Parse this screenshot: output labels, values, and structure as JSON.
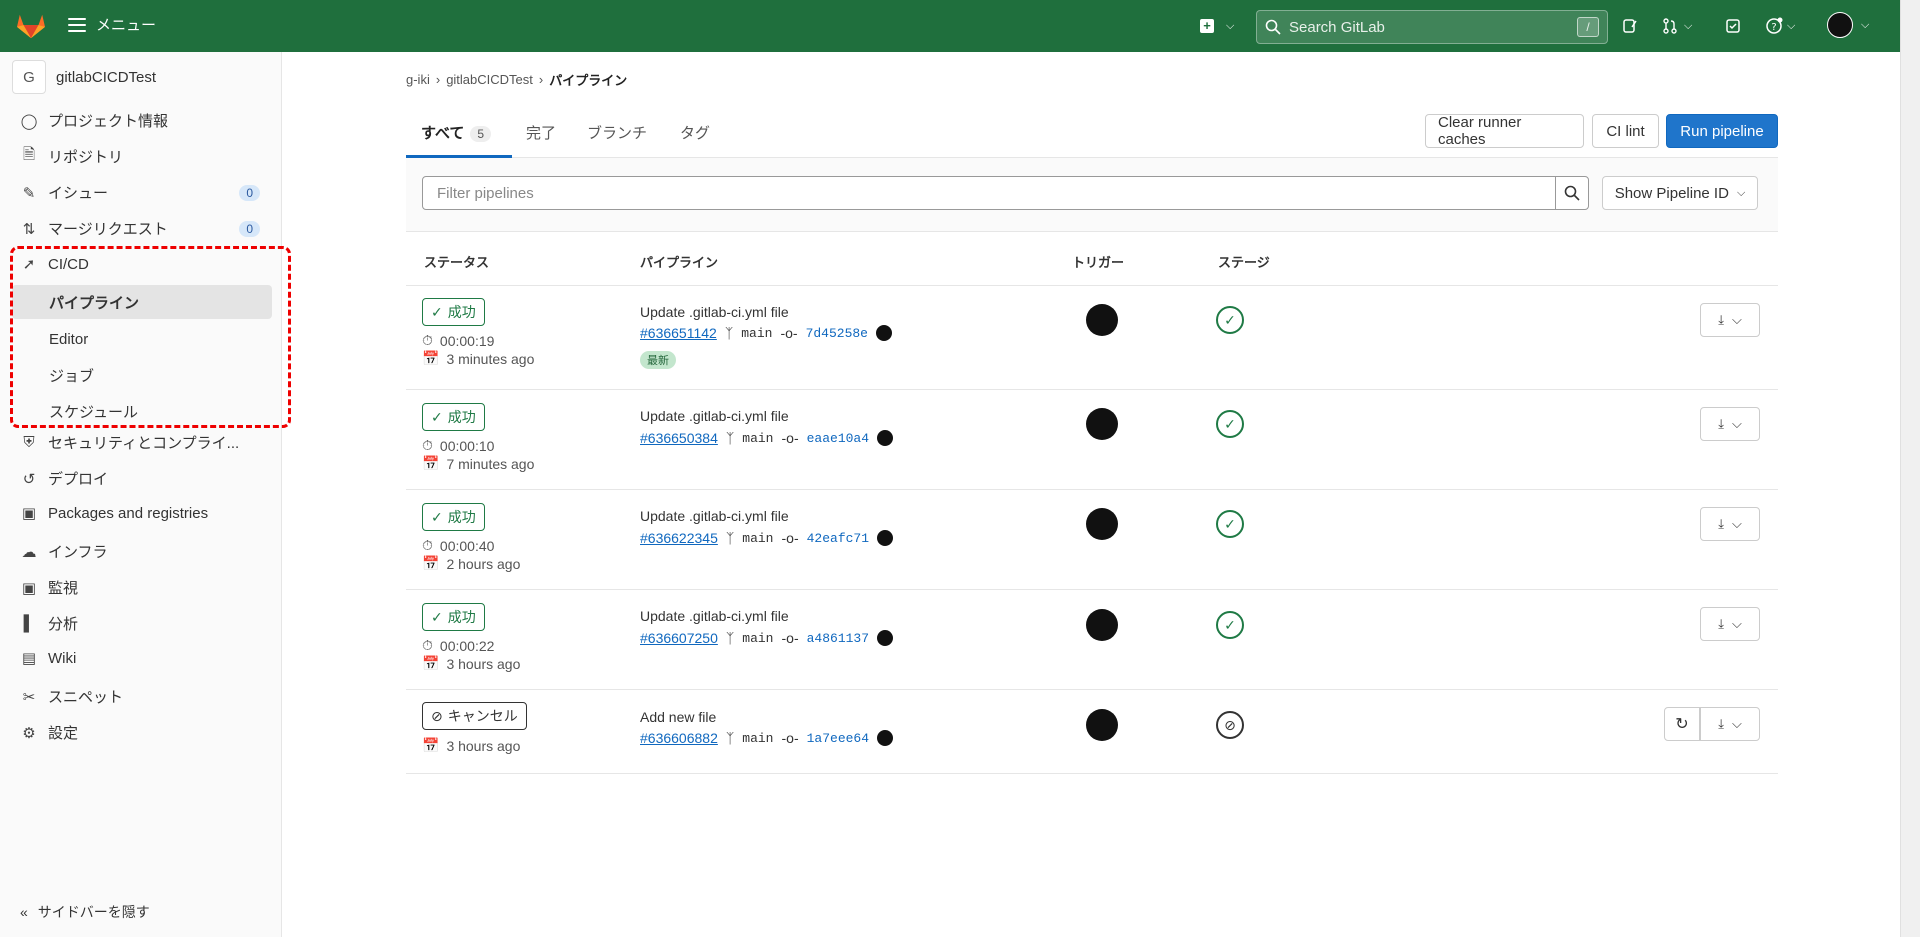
{
  "topbar": {
    "menu_label": "メニュー",
    "search_placeholder": "Search GitLab",
    "search_shortcut": "/"
  },
  "sidebar": {
    "project_initial": "G",
    "project_name": "gitlabCICDTest",
    "items": [
      {
        "label": "プロジェクト情報",
        "icon": "project-icon"
      },
      {
        "label": "リポジトリ",
        "icon": "document-icon"
      },
      {
        "label": "イシュー",
        "icon": "issues-icon",
        "badge": "0"
      },
      {
        "label": "マージリクエスト",
        "icon": "merge-request-icon",
        "badge": "0"
      },
      {
        "label": "CI/CD",
        "icon": "rocket-icon"
      },
      {
        "label": "セキュリティとコンプライ...",
        "icon": "shield-icon"
      },
      {
        "label": "デプロイ",
        "icon": "deploy-icon"
      },
      {
        "label": "Packages and registries",
        "icon": "package-icon"
      },
      {
        "label": "インフラ",
        "icon": "cloud-icon"
      },
      {
        "label": "監視",
        "icon": "monitor-icon"
      },
      {
        "label": "分析",
        "icon": "chart-icon"
      },
      {
        "label": "Wiki",
        "icon": "book-icon"
      },
      {
        "label": "スニペット",
        "icon": "scissors-icon"
      },
      {
        "label": "設定",
        "icon": "gear-icon"
      }
    ],
    "cicd_sub": [
      "パイプライン",
      "Editor",
      "ジョブ",
      "スケジュール"
    ],
    "hide_label": "サイドバーを隠す"
  },
  "breadcrumb": [
    "g-iki",
    "gitlabCICDTest",
    "パイプライン"
  ],
  "tabs": [
    {
      "label": "すべて",
      "count": "5"
    },
    {
      "label": "完了"
    },
    {
      "label": "ブランチ"
    },
    {
      "label": "タグ"
    }
  ],
  "actions": {
    "clear_caches": "Clear runner caches",
    "ci_lint": "CI lint",
    "run_pipeline": "Run pipeline"
  },
  "filter": {
    "placeholder": "Filter pipelines",
    "show_id": "Show Pipeline ID"
  },
  "columns": [
    "ステータス",
    "パイプライン",
    "トリガー",
    "ステージ"
  ],
  "pipelines": [
    {
      "status": "成功",
      "duration": "00:00:19",
      "ago": "3 minutes ago",
      "title": "Update .gitlab-ci.yml file",
      "id": "#636651142",
      "branch": "main",
      "sha": "7d45258e",
      "latest": "最新"
    },
    {
      "status": "成功",
      "duration": "00:00:10",
      "ago": "7 minutes ago",
      "title": "Update .gitlab-ci.yml file",
      "id": "#636650384",
      "branch": "main",
      "sha": "eaae10a4"
    },
    {
      "status": "成功",
      "duration": "00:00:40",
      "ago": "2 hours ago",
      "title": "Update .gitlab-ci.yml file",
      "id": "#636622345",
      "branch": "main",
      "sha": "42eafc71"
    },
    {
      "status": "成功",
      "duration": "00:00:22",
      "ago": "3 hours ago",
      "title": "Update .gitlab-ci.yml file",
      "id": "#636607250",
      "branch": "main",
      "sha": "a4861137"
    },
    {
      "status": "キャンセル",
      "ago": "3 hours ago",
      "title": "Add new file",
      "id": "#636606882",
      "branch": "main",
      "sha": "1a7eee64"
    }
  ],
  "colors": {
    "topbar": "#1f6f3d",
    "primary": "#1f75cb",
    "success": "#1f7a45",
    "highlight": "#e00000"
  }
}
